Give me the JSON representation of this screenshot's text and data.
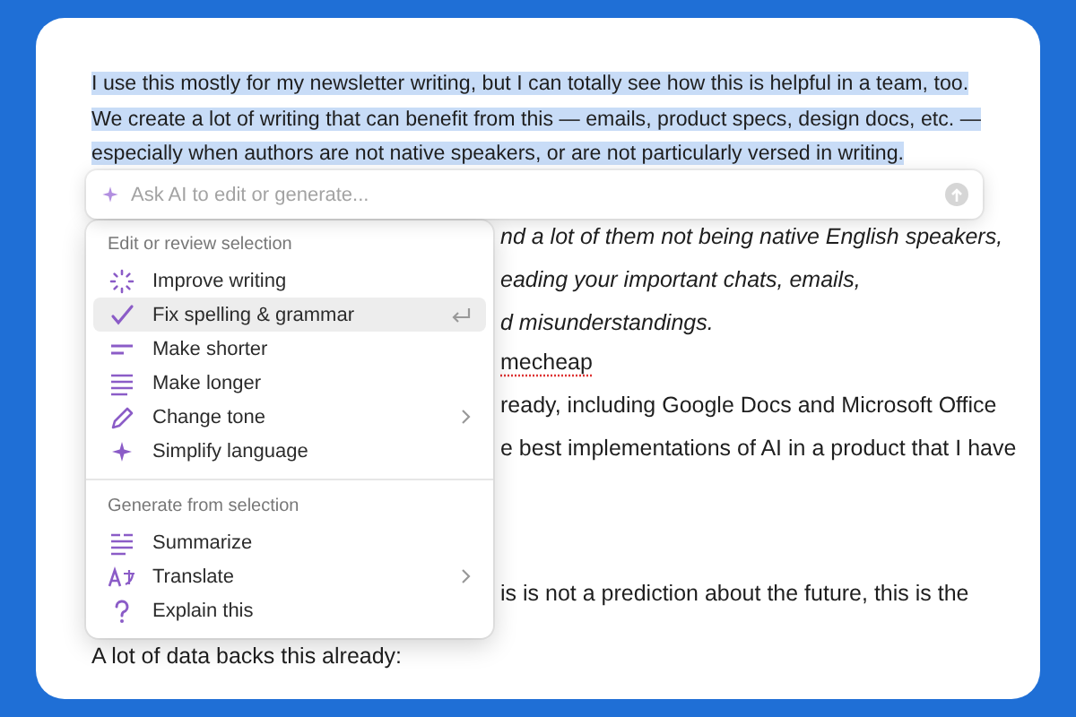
{
  "document": {
    "selected_paragraph": "I use this mostly for my newsletter writing, but I can totally see how this is helpful in a team, too. We create a lot of writing that can benefit from this — emails, product specs, design docs, etc. — especially when authors are not native speakers, or are not particularly versed in writing.",
    "fragments": [
      {
        "text": "nd a lot of them not being native English speakers,",
        "kind": "quote"
      },
      {
        "text": "eading your important chats, emails,",
        "kind": "quote"
      },
      {
        "text": "d misunderstandings.",
        "kind": "quote"
      },
      {
        "text": "mecheap",
        "kind": "misspelled"
      },
      {
        "text": "ready, including Google Docs and Microsoft Office",
        "kind": "plain"
      },
      {
        "text": "e best implementations of AI in a product that I have",
        "kind": "plain"
      },
      {
        "text": "is is not a prediction about the future, this is the",
        "kind": "plain"
      }
    ],
    "closing_line": "A lot of data backs this already:"
  },
  "ai_prompt": {
    "placeholder": "Ask AI to edit or generate..."
  },
  "menu": {
    "sections": [
      {
        "heading": "Edit or review selection",
        "items": [
          {
            "label": "Improve writing",
            "kind": "improve",
            "selected": false,
            "submenu": false
          },
          {
            "label": "Fix spelling & grammar",
            "kind": "check",
            "selected": true,
            "submenu": false
          },
          {
            "label": "Make shorter",
            "kind": "shorter",
            "selected": false,
            "submenu": false
          },
          {
            "label": "Make longer",
            "kind": "longer",
            "selected": false,
            "submenu": false
          },
          {
            "label": "Change tone",
            "kind": "tone",
            "selected": false,
            "submenu": true
          },
          {
            "label": "Simplify language",
            "kind": "simplify",
            "selected": false,
            "submenu": false
          }
        ]
      },
      {
        "heading": "Generate from selection",
        "items": [
          {
            "label": "Summarize",
            "kind": "summarize",
            "selected": false,
            "submenu": false
          },
          {
            "label": "Translate",
            "kind": "translate",
            "selected": false,
            "submenu": true
          },
          {
            "label": "Explain this",
            "kind": "explain",
            "selected": false,
            "submenu": false
          }
        ]
      }
    ]
  }
}
